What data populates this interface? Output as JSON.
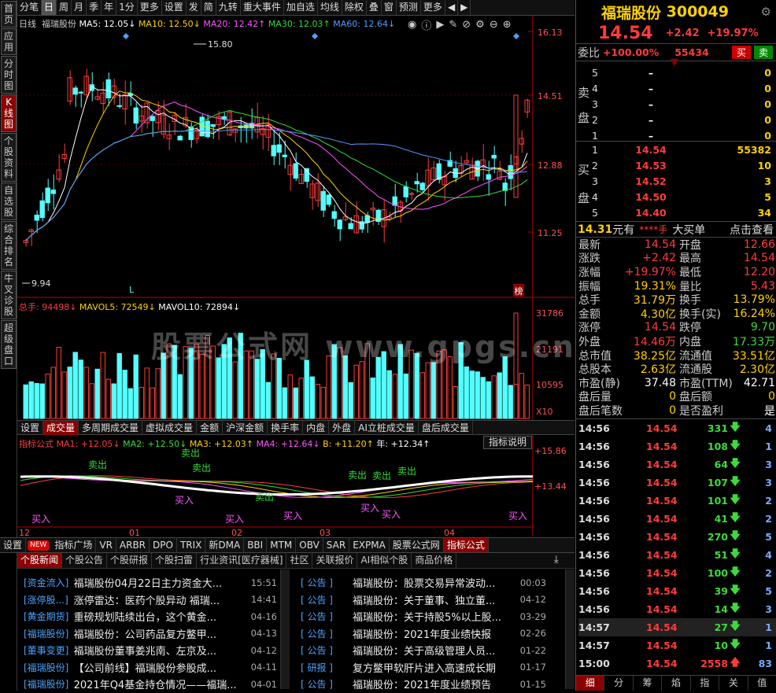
{
  "left_tabs": [
    "首页",
    "应用",
    "分时图",
    "K线图",
    "个股资料",
    "自选股",
    "综合排名",
    "牛叉诊股",
    "超级盘口"
  ],
  "toolbar": [
    "分笔",
    "日",
    "周",
    "月",
    "季",
    "年",
    "1分",
    "更多",
    "设置",
    "发",
    "简",
    "九转",
    "重大事件",
    "加自选",
    "均线",
    "除权",
    "叠",
    "窗",
    "预测",
    "更多"
  ],
  "chart_legend": {
    "type": "日线",
    "name": "福瑞股份",
    "ma5": "MA5: 12.05↓",
    "ma10": "MA10: 12.50↓",
    "ma20": "MA20: 12.42↑",
    "ma30": "MA30: 12.03↑",
    "ma60": "MA60: 12.64↓"
  },
  "price_axis": [
    "16.13",
    "14.51",
    "12.88",
    "11.25"
  ],
  "high_label": "15.80",
  "low_label": "9.94",
  "marker_l": "L",
  "bang": "榜",
  "vol_legend": {
    "total": "总手: 94498↓",
    "mavol5": "MAVOL5: 72549↓",
    "mavol10": "MAVOL10: 72894↓"
  },
  "vol_axis": [
    "31786",
    "21191",
    "10595",
    "X10"
  ],
  "watermark": "股票公式网 www.gpgs.cn",
  "vol_tabs": [
    "设置",
    "成交量",
    "多周期成交量",
    "虚拟成交量",
    "金额",
    "沪深金额",
    "换手率",
    "内盘",
    "外盘",
    "AI立桩成交量",
    "盘后成交量"
  ],
  "ind_legend": {
    "name": "指标公式",
    "ma1": "MA1: +12.05↓",
    "ma2": "MA2: +12.50↓",
    "ma3": "MA3: +12.03↑",
    "ma4": "MA4: +12.64↓",
    "b": "B: +11.20↑",
    "year": "年: +12.34↑",
    "help": "指标说明"
  },
  "ind_axis": [
    "+15.86",
    "+13.44"
  ],
  "ind_signals": {
    "sell": "卖出",
    "buy": "买入"
  },
  "date_axis": [
    "12",
    "01",
    "02",
    "03",
    "04"
  ],
  "bottom_tabs": [
    "设置",
    "NEW",
    "指标广场",
    "VR",
    "ARBR",
    "DPO",
    "TRIX",
    "新DMA",
    "BBI",
    "MTM",
    "OBV",
    "SAR",
    "EXPMA",
    "股票公式网",
    "指标公式"
  ],
  "news_tabs": [
    "个股新闻",
    "个股公告",
    "个股研报",
    "个股扫雷",
    "行业资讯[医疗器械]",
    "社区",
    "关联报价",
    "AI相似个股",
    "商品价格"
  ],
  "news_left": [
    {
      "tag": "[资金流入]",
      "title": "福瑞股份04月22日主力资金大...",
      "date": "15:51"
    },
    {
      "tag": "[涨停股...]",
      "title": "涨停雷达：医药个股异动 福瑞...",
      "date": "14:41"
    },
    {
      "tag": "[黄金期货]",
      "title": "重磅规划陆续出台，这个黄金...",
      "date": "04-16"
    },
    {
      "tag": "[福瑞股份]",
      "title": "福瑞股份：公司药品复方鳖甲...",
      "date": "04-13"
    },
    {
      "tag": "[董事变更]",
      "title": "福瑞股份董事姜兆南、左京及...",
      "date": "04-12"
    },
    {
      "tag": "[福瑞股份]",
      "title": "【公司前线】福瑞股份参股成...",
      "date": "04-11"
    },
    {
      "tag": "[福瑞股份]",
      "title": "2021年Q4基金持仓情况——福瑞...",
      "date": "04-01"
    }
  ],
  "news_right": [
    {
      "tag": "[ 公告 ]",
      "title": "福瑞股份：股票交易异常波动...",
      "date": "00:03"
    },
    {
      "tag": "[ 公告 ]",
      "title": "福瑞股份：关于董事、独立董...",
      "date": "04-12"
    },
    {
      "tag": "[ 公告 ]",
      "title": "福瑞股份：关于持股5%以上股...",
      "date": "03-29"
    },
    {
      "tag": "[ 公告 ]",
      "title": "福瑞股份：2021年度业绩快报",
      "date": "02-26"
    },
    {
      "tag": "[ 公告 ]",
      "title": "福瑞股份：关于高级管理人员...",
      "date": "01-22"
    },
    {
      "tag": "[ 研报 ]",
      "title": "复方鳖甲软肝片进入高速成长期",
      "date": "01-17"
    },
    {
      "tag": "[ 公告 ]",
      "title": "福瑞股份：2021年度业绩预告",
      "date": "01-15"
    }
  ],
  "stock": {
    "name": "福瑞股份",
    "code": "300049",
    "price": "14.54",
    "change": "+2.42",
    "pct": "+19.97%"
  },
  "weibi": {
    "label": "委比",
    "pct": "+100.00%",
    "val": "55434",
    "sell": "买",
    "buy": "卖"
  },
  "sell_side_label": [
    "卖",
    "盘"
  ],
  "buy_side_label": [
    "买",
    "盘"
  ],
  "asks": [
    {
      "lvl": "5",
      "price": "–",
      "vol": "0"
    },
    {
      "lvl": "4",
      "price": "–",
      "vol": "0"
    },
    {
      "lvl": "3",
      "price": "–",
      "vol": "0"
    },
    {
      "lvl": "2",
      "price": "–",
      "vol": "0"
    },
    {
      "lvl": "1",
      "price": "–",
      "vol": "0"
    }
  ],
  "bids": [
    {
      "lvl": "1",
      "price": "14.54",
      "vol": "55382"
    },
    {
      "lvl": "2",
      "price": "14.53",
      "vol": "10"
    },
    {
      "lvl": "3",
      "price": "14.52",
      "vol": "3"
    },
    {
      "lvl": "4",
      "price": "14.50",
      "vol": "5"
    },
    {
      "lvl": "5",
      "price": "14.40",
      "vol": "34"
    }
  ],
  "big_order": {
    "amount": "14.31",
    "unit": "元有",
    "hands": "****手",
    "label": "大买单",
    "link": "点击查看"
  },
  "stats": [
    {
      "k1": "最新",
      "v1": "14.54",
      "c1": "red",
      "k2": "开盘",
      "v2": "12.66",
      "c2": "red"
    },
    {
      "k1": "涨跌",
      "v1": "+2.42",
      "c1": "red",
      "k2": "最高",
      "v2": "14.54",
      "c2": "red"
    },
    {
      "k1": "涨幅",
      "v1": "+19.97%",
      "c1": "red",
      "k2": "最低",
      "v2": "12.20",
      "c2": "red"
    },
    {
      "k1": "振幅",
      "v1": "19.31%",
      "c1": "yellow",
      "k2": "量比",
      "v2": "5.43",
      "c2": "red"
    },
    {
      "k1": "总手",
      "v1": "31.79万",
      "c1": "yellow",
      "k2": "换手",
      "v2": "13.79%",
      "c2": "yellow"
    },
    {
      "k1": "金额",
      "v1": "4.30亿",
      "c1": "yellow",
      "k2": "换手(实)",
      "v2": "16.24%",
      "c2": "yellow"
    },
    {
      "k1": "涨停",
      "v1": "14.54",
      "c1": "red",
      "k2": "跌停",
      "v2": "9.70",
      "c2": "green"
    },
    {
      "k1": "外盘",
      "v1": "14.46万",
      "c1": "red",
      "k2": "内盘",
      "v2": "17.33万",
      "c2": "green"
    },
    {
      "k1": "总市值",
      "v1": "38.25亿",
      "c1": "yellow",
      "k2": "流通值",
      "v2": "33.51亿",
      "c2": "yellow"
    },
    {
      "k1": "总股本",
      "v1": "2.63亿",
      "c1": "yellow",
      "k2": "流通股",
      "v2": "2.30亿",
      "c2": "yellow"
    },
    {
      "k1": "市盈(静)",
      "v1": "37.48",
      "c1": "white",
      "k2": "市盈(TTM)",
      "v2": "42.71",
      "c2": "white"
    },
    {
      "k1": "盘后量",
      "v1": "0",
      "c1": "yellow",
      "k2": "盘后额",
      "v2": "0",
      "c2": "yellow"
    },
    {
      "k1": "盘后笔数",
      "v1": "0",
      "c1": "yellow",
      "k2": "是否盈利",
      "v2": "是",
      "c2": "white"
    }
  ],
  "ticks": [
    {
      "time": "14:56",
      "price": "14.54",
      "vol": "331",
      "dir": "down",
      "n": "4"
    },
    {
      "time": "14:56",
      "price": "14.54",
      "vol": "108",
      "dir": "down",
      "n": "1"
    },
    {
      "time": "14:56",
      "price": "14.54",
      "vol": "64",
      "dir": "down",
      "n": "3"
    },
    {
      "time": "14:56",
      "price": "14.54",
      "vol": "107",
      "dir": "down",
      "n": "3"
    },
    {
      "time": "14:56",
      "price": "14.54",
      "vol": "101",
      "dir": "down",
      "n": "2"
    },
    {
      "time": "14:56",
      "price": "14.54",
      "vol": "41",
      "dir": "down",
      "n": "2"
    },
    {
      "time": "14:56",
      "price": "14.54",
      "vol": "270",
      "dir": "down",
      "n": "5"
    },
    {
      "time": "14:56",
      "price": "14.54",
      "vol": "51",
      "dir": "down",
      "n": "4"
    },
    {
      "time": "14:56",
      "price": "14.54",
      "vol": "100",
      "dir": "down",
      "n": "2"
    },
    {
      "time": "14:56",
      "price": "14.54",
      "vol": "39",
      "dir": "down",
      "n": "5"
    },
    {
      "time": "14:56",
      "price": "14.54",
      "vol": "14",
      "dir": "down",
      "n": "3"
    },
    {
      "time": "14:57",
      "price": "14.54",
      "vol": "27",
      "dir": "down",
      "n": "1"
    },
    {
      "time": "14:57",
      "price": "14.54",
      "vol": "10",
      "dir": "down",
      "n": "1"
    },
    {
      "time": "15:00",
      "price": "14.54",
      "vol": "2558",
      "dir": "up",
      "n": "83"
    }
  ],
  "bottom_right_tabs": [
    "细",
    "分",
    "筹",
    "焰",
    "指",
    "关",
    "值"
  ],
  "colors": {
    "up": "#ff3c3c",
    "down": "#54ffff",
    "accent": "#ffd200",
    "ma5": "#ffffff",
    "ma10": "#ffd200",
    "ma20": "#ff55ff",
    "ma30": "#33dd33",
    "ma60": "#5599ff"
  }
}
